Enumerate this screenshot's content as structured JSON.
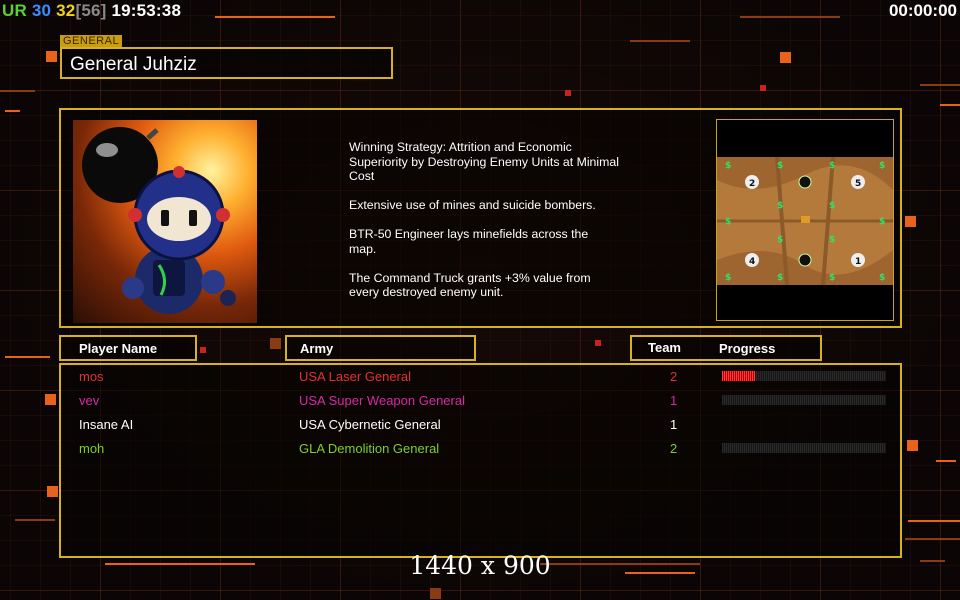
{
  "status_bar": {
    "ur_label": "UR",
    "num_a": "30",
    "num_b": "32",
    "bracket": "[56]",
    "clock": "19:53:38",
    "timer": "00:00:00",
    "colors": {
      "ur": "#59d332",
      "num_a": "#3f8cff",
      "num_b": "#f2d21b",
      "bracket": "#8a8a8a"
    }
  },
  "general": {
    "tag": "GENERAL",
    "name": "General Juhziz"
  },
  "strategy": {
    "paragraphs": [
      "Winning Strategy: Attrition and Economic\n Superiority by Destroying Enemy Units at Minimal\n Cost",
      "Extensive use of mines and suicide bombers.",
      "BTR-50 Engineer lays minefields across the\n map.",
      "The Command Truck grants +3% value from\n every destroyed enemy unit."
    ]
  },
  "portrait": {
    "icon": "bomberman-portrait-icon"
  },
  "minimap": {
    "icon": "minimap-icon",
    "start_positions": [
      "2",
      "5",
      "4",
      "1"
    ]
  },
  "table": {
    "headers": {
      "player": "Player Name",
      "army": "Army",
      "team": "Team",
      "progress": "Progress"
    },
    "rows": [
      {
        "player": "mos",
        "army": "USA Laser General",
        "team": "2",
        "color": "#e23232",
        "progress": 0.2,
        "has_bar": true
      },
      {
        "player": "vev",
        "army": "USA Super Weapon General",
        "team": "1",
        "color": "#d62aa6",
        "progress": 0,
        "has_bar": true
      },
      {
        "player": "Insane AI",
        "army": "USA Cybernetic General",
        "team": "1",
        "color": "#ffffff",
        "progress": 0,
        "has_bar": false
      },
      {
        "player": "moh",
        "army": "GLA Demolition General",
        "team": "2",
        "color": "#7ed02a",
        "progress": 0,
        "has_bar": true
      }
    ]
  },
  "resolution": "1440 x 900",
  "accent": "#d6b21e"
}
